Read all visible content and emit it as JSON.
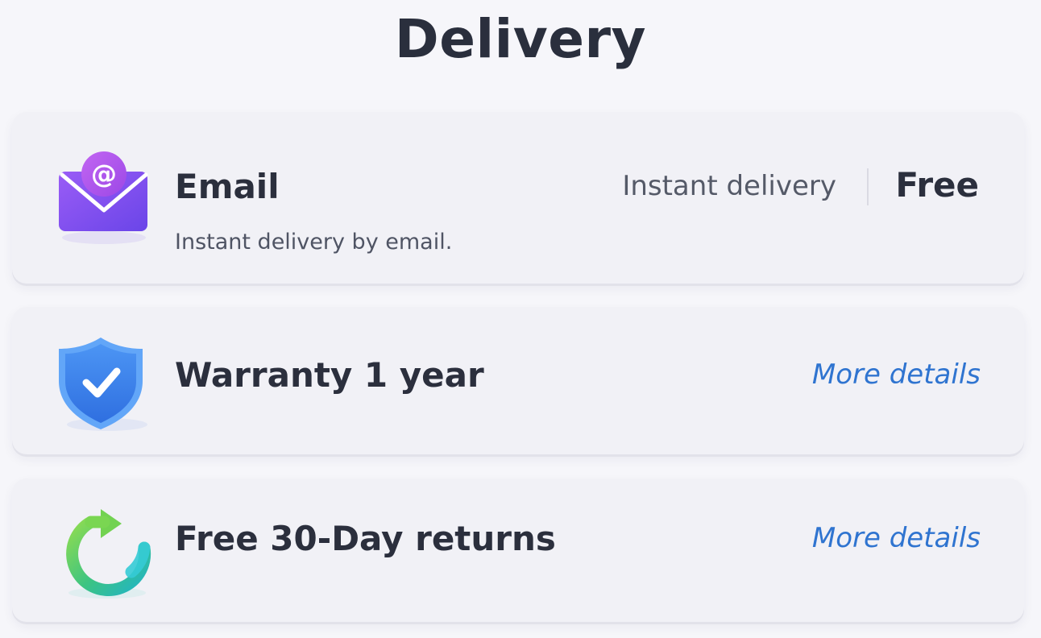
{
  "page": {
    "title": "Delivery"
  },
  "options": {
    "email": {
      "icon": "email-at-icon",
      "title": "Email",
      "description": "Instant delivery by email.",
      "speed": "Instant delivery",
      "price": "Free"
    },
    "warranty": {
      "icon": "shield-check-icon",
      "title": "Warranty 1 year",
      "link": "More details"
    },
    "returns": {
      "icon": "returns-cycle-icon",
      "title": "Free 30-Day returns",
      "link": "More details"
    }
  },
  "colors": {
    "background": "#f6f6fa",
    "card": "#f1f1f6",
    "text": "#2b2f3d",
    "muted_text": "#555a68",
    "link": "#2f74d0",
    "email_icon": "#8b4ff0",
    "shield_icon": "#3b86f0",
    "returns_icon_start": "#7ed957",
    "returns_icon_end": "#23b7c8"
  }
}
